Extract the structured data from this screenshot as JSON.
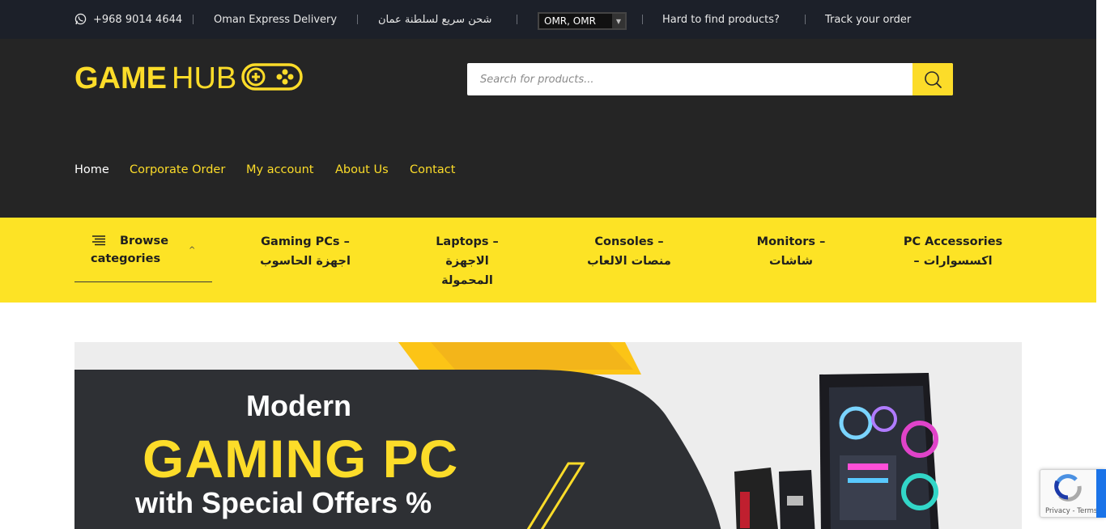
{
  "topbar": {
    "phone": "+968 9014 4644",
    "delivery": "Oman Express Delivery",
    "delivery_ar": "شحن سريع لسلطنة عمان",
    "currency": "OMR, OMR",
    "hard_to_find": "Hard to find products?",
    "track_order": "Track your order"
  },
  "header": {
    "logo_text_bold": "GAME",
    "logo_text_light": "HUB",
    "search_placeholder": "Search for products..."
  },
  "nav": {
    "items": [
      {
        "label": "Home"
      },
      {
        "label": "Corporate Order"
      },
      {
        "label": "My account"
      },
      {
        "label": "About Us"
      },
      {
        "label": "Contact"
      }
    ]
  },
  "categories": {
    "browse_label": "Browse categories",
    "items": [
      {
        "line1": "Gaming PCs –",
        "line2": "اجهزة الحاسوب",
        "line3": ""
      },
      {
        "line1": "Laptops –",
        "line2": "الاجهزة",
        "line3": "المحمولة"
      },
      {
        "line1": "Consoles –",
        "line2": "منصات الالعاب",
        "line3": ""
      },
      {
        "line1": "Monitors –",
        "line2": "شاشات",
        "line3": ""
      },
      {
        "line1": "PC Accessories",
        "line2": "– اكسسوارات",
        "line3": ""
      }
    ]
  },
  "banner": {
    "line1": "Modern",
    "line2": "GAMING PC",
    "line3": "with Special Offers %"
  },
  "recaptcha": {
    "links": "Privacy - Terms"
  },
  "colors": {
    "topbar_bg": "#1c2029",
    "header_bg": "#252525",
    "accent_yellow": "#fcdc29",
    "catbar_bg": "#fde325",
    "banner_dark": "#2e3034"
  },
  "icons": {
    "phone": "whatsapp-icon",
    "search": "search-icon",
    "browse": "list-icon",
    "browse_toggle": "chevron-up-icon",
    "recaptcha": "recaptcha-icon"
  }
}
